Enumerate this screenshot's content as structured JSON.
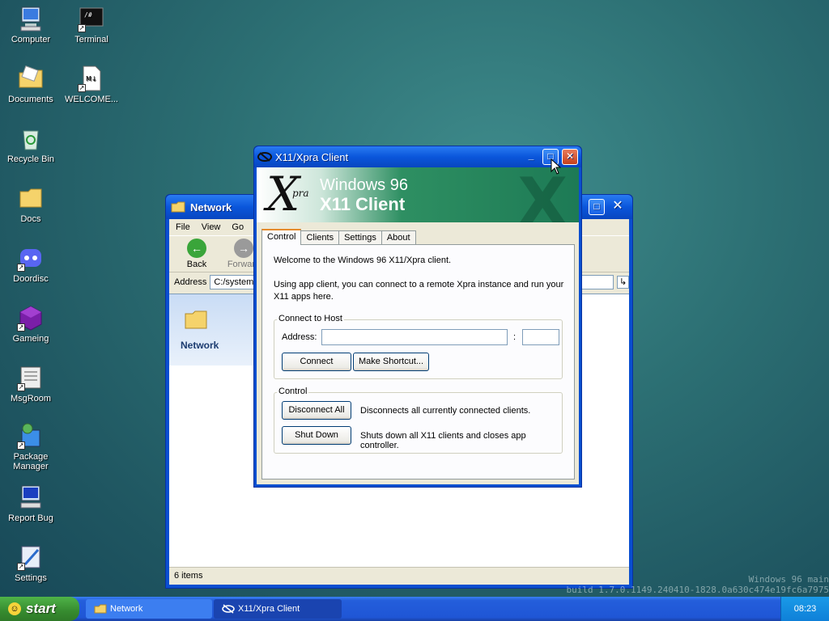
{
  "desktop": {
    "icons": [
      {
        "label": "Computer"
      },
      {
        "label": "Terminal"
      },
      {
        "label": "Documents"
      },
      {
        "label": "WELCOME..."
      },
      {
        "label": "Recycle Bin"
      },
      {
        "label": "Docs"
      },
      {
        "label": "Doordisc"
      },
      {
        "label": "Gameing"
      },
      {
        "label": "MsgRoom"
      },
      {
        "label": "Package Manager"
      },
      {
        "label": "Report Bug"
      },
      {
        "label": "Settings"
      }
    ],
    "watermark_line1": "Windows 96 main",
    "watermark_line2": "build 1.7.0.1149.240410-1828.0a630c474e19fc6a7975"
  },
  "network_window": {
    "title": "Network",
    "menu": [
      "File",
      "View",
      "Go"
    ],
    "toolbar": {
      "back": "Back",
      "forward": "Forward"
    },
    "address_label": "Address",
    "address_value": "C:/system/",
    "folder_label": "Network",
    "status": "6 items"
  },
  "xpra_window": {
    "title": "X11/Xpra Client",
    "banner": {
      "logo_x": "X",
      "logo_sub": "pra",
      "line1": "Windows 96",
      "line2": "X11 Client"
    },
    "tabs": [
      "Control",
      "Clients",
      "Settings",
      "About"
    ],
    "welcome": "Welcome to the Windows 96 X11/Xpra client.",
    "intro": "Using app client, you can connect to a remote Xpra instance and run your X11 apps here.",
    "connect_group": {
      "legend": "Connect to Host",
      "address_label": "Address:",
      "address_value": "",
      "port_separator": ":",
      "port_value": "",
      "connect_button": "Connect",
      "shortcut_button": "Make Shortcut..."
    },
    "control_group": {
      "legend": "Control",
      "disconnect_button": "Disconnect All",
      "disconnect_desc": "Disconnects all currently connected clients.",
      "shutdown_button": "Shut Down",
      "shutdown_desc": "Shuts down all X11 clients and closes app controller."
    }
  },
  "taskbar": {
    "start": "start",
    "items": [
      {
        "label": "Network"
      },
      {
        "label": "X11/Xpra Client"
      }
    ],
    "clock": "08:23"
  },
  "colors": {
    "accent": "#0a56db",
    "start_green": "#368b2f"
  }
}
